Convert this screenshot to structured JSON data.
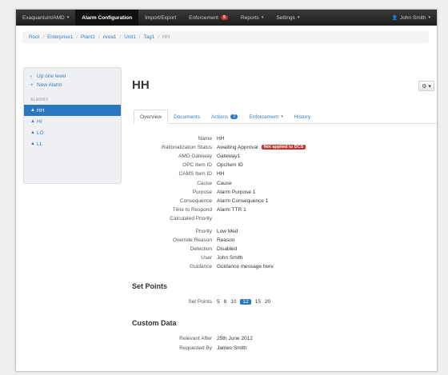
{
  "navbar": {
    "items": [
      {
        "label": "Exaquantum/AMD",
        "caret": true,
        "active": false
      },
      {
        "label": "Alarm Configuration",
        "caret": false,
        "active": true
      },
      {
        "label": "Import/Export",
        "caret": false,
        "active": false
      },
      {
        "label": "Enforcement",
        "caret": false,
        "active": false,
        "badge": "5"
      },
      {
        "label": "Reports",
        "caret": true,
        "active": false
      },
      {
        "label": "Settings",
        "caret": true,
        "active": false
      }
    ],
    "user": "John Smith",
    "caret_glyph": "▾",
    "user_glyph": "👤"
  },
  "breadcrumb": {
    "items": [
      "Root",
      "Enterprise1",
      "Plant1",
      "Area1",
      "Unit1",
      "Tag1"
    ],
    "current": "HH",
    "separator": "/"
  },
  "sidebar": {
    "up_label": "Up one level",
    "new_label": "New Alarm",
    "heading": "ALARMS",
    "items": [
      {
        "label": "HH",
        "active": true
      },
      {
        "label": "HI",
        "active": false
      },
      {
        "label": "LO",
        "active": false
      },
      {
        "label": "LL",
        "active": false
      }
    ]
  },
  "page": {
    "title": "HH",
    "gear_glyph": "⚙ ▾"
  },
  "tabs": [
    {
      "label": "Overview",
      "active": true
    },
    {
      "label": "Documents",
      "active": false
    },
    {
      "label": "Actions",
      "active": false,
      "badge": "2"
    },
    {
      "label": "Enforcement",
      "active": false,
      "caret": true
    },
    {
      "label": "History",
      "active": false
    }
  ],
  "details": [
    {
      "key": "Name",
      "value": "HH"
    },
    {
      "key": "Rationalization Status",
      "value": "Awaiting Approval",
      "label": "Not applied to DCS"
    },
    {
      "key": "AMD Gateway",
      "value": "Gateway1"
    },
    {
      "key": "OPC Item ID",
      "value": "OpcItem ID"
    },
    {
      "key": "CAMS Item ID",
      "value": "HH"
    },
    {
      "key": "Cause",
      "value": "Cause"
    },
    {
      "key": "Purpose",
      "value": "Alarm Purpose 1"
    },
    {
      "key": "Consequence",
      "value": "Alarm Consequence 1"
    },
    {
      "key": "Time to Respond",
      "value": "Alarm TTR 1"
    },
    {
      "key": "Calculated Priority",
      "value": ""
    },
    {
      "key": "Priority",
      "value": "Low Med"
    },
    {
      "key": "Override Reason",
      "value": "Reason"
    },
    {
      "key": "Detection",
      "value": "Disabled"
    },
    {
      "key": "User",
      "value": "John Smith"
    },
    {
      "key": "Guidance",
      "value": "Guidance message here"
    }
  ],
  "set_points": {
    "heading": "Set Points",
    "key": "Set Points",
    "values": [
      {
        "v": "5",
        "active": false
      },
      {
        "v": "8",
        "active": false
      },
      {
        "v": "10",
        "active": false
      },
      {
        "v": "12",
        "active": true
      },
      {
        "v": "15",
        "active": false
      },
      {
        "v": "20",
        "active": false
      }
    ]
  },
  "custom_data": {
    "heading": "Custom Data",
    "rows": [
      {
        "key": "Relevant After",
        "value": "25th June 2012"
      },
      {
        "key": "Requested By",
        "value": "James Smith"
      }
    ]
  },
  "colors": {
    "accent": "#2a77c0",
    "danger": "#c9302c",
    "navbar": "#222222",
    "link": "#3a7bbf"
  }
}
